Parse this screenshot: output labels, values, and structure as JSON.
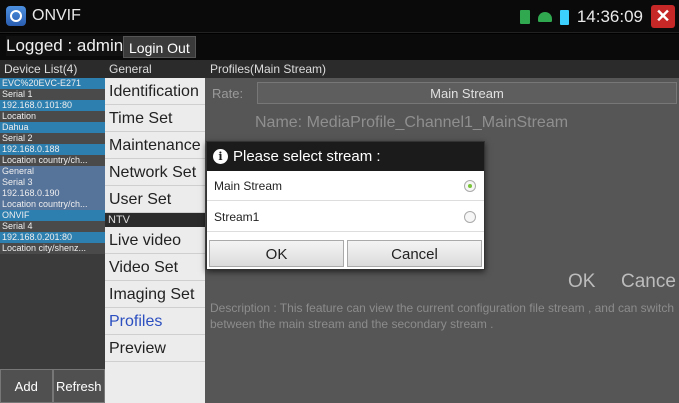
{
  "app": {
    "title": "ONVIF",
    "time": "14:36:09",
    "close_glyph": "✕"
  },
  "login": {
    "logged_text": "Logged : admin",
    "logout_label": "Login Out"
  },
  "headers": {
    "devices": "Device List(4)",
    "general": "General",
    "profiles": "Profiles(Main Stream)"
  },
  "devices": [
    {
      "lines": [
        "EVC%20EVC-E271",
        "Serial 1",
        "192.168.0.101:80",
        "Location"
      ],
      "selected": false
    },
    {
      "lines": [
        "Dahua",
        "Serial 2",
        "192.168.0.188",
        "Location country/ch..."
      ],
      "selected": false
    },
    {
      "lines": [
        "General",
        "Serial 3",
        "192.168.0.190",
        "Location country/ch..."
      ],
      "selected": true
    },
    {
      "lines": [
        "ONVIF",
        "Serial 4",
        "192.168.0.201:80",
        "Location city/shenz..."
      ],
      "selected": false
    }
  ],
  "device_buttons": {
    "add": "Add",
    "refresh": "Refresh"
  },
  "menu": {
    "items_general": [
      "Identification",
      "Time Set",
      "Maintenance",
      "Network Set",
      "User Set"
    ],
    "separator": "NTV",
    "items_ntv": [
      "Live video",
      "Video Set",
      "Imaging Set",
      "Profiles",
      "Preview"
    ],
    "active": "Profiles"
  },
  "main": {
    "rate_label": "Rate:",
    "rate_value": "Main Stream",
    "name_line": "Name: MediaProfile_Channel1_MainStream",
    "ok": "OK",
    "cancel": "Cance",
    "description": "Description : This feature can view the current configuration file stream , and can switch between the main stream and the secondary stream ."
  },
  "dialog": {
    "title": "Please select stream :",
    "options": [
      {
        "label": "Main Stream",
        "selected": true
      },
      {
        "label": "Stream1",
        "selected": false
      }
    ],
    "ok": "OK",
    "cancel": "Cancel"
  },
  "colors": {
    "selected_device": "#56739a",
    "radio_on": "#7ac43a",
    "active_menu": "#2c4fc0",
    "close": "#c62828"
  }
}
